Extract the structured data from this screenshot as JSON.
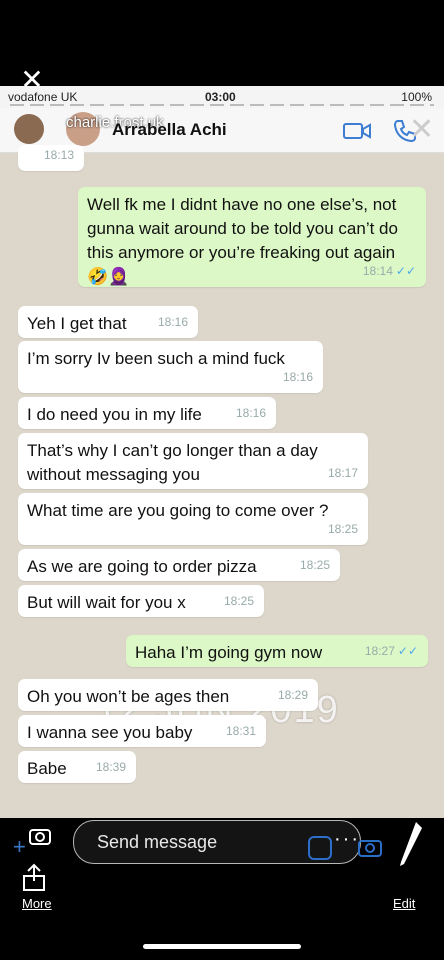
{
  "story": {
    "close_icon": "✕",
    "more_label": "More",
    "edit_label": "Edit"
  },
  "status_bar": {
    "carrier": "vodafone UK",
    "time": "03:00",
    "battery": "100%"
  },
  "header": {
    "overlay_username": "charlie.frost.uk",
    "contact_name": "Arrabella Achi"
  },
  "chat": {
    "top_timestamp": "18:13",
    "date_overlay": "12 JUN 2019",
    "messages": [
      {
        "dir": "out",
        "text": "Well fk me I didnt have no one else’s, not gunna wait around to be told you can’t do this anymore or you’re freaking out again 🤣🧕",
        "time": "18:14"
      },
      {
        "dir": "in",
        "text": "Yeh I get that",
        "time": "18:16"
      },
      {
        "dir": "in",
        "text": "I’m sorry Iv been such a mind fuck",
        "time": "18:16"
      },
      {
        "dir": "in",
        "text": "I do need you in my life",
        "time": "18:16"
      },
      {
        "dir": "in",
        "text": "That’s why I can’t go longer than a day without messaging you",
        "time": "18:17"
      },
      {
        "dir": "in",
        "text": "What time are you going to come over ?",
        "time": "18:25"
      },
      {
        "dir": "in",
        "text": "As we are going to order pizza",
        "time": "18:25"
      },
      {
        "dir": "in",
        "text": "But will wait for you x",
        "time": "18:25"
      },
      {
        "dir": "out",
        "text": "Haha I’m going gym now",
        "time": "18:27"
      },
      {
        "dir": "in",
        "text": "Oh you won’t be ages then",
        "time": "18:29"
      },
      {
        "dir": "in",
        "text": "I wanna see you baby",
        "time": "18:31"
      },
      {
        "dir": "in",
        "text": "Babe",
        "time": "18:39"
      },
      {
        "dir": "in",
        "text": "👀",
        "time": ""
      }
    ]
  },
  "composer": {
    "placeholder": "Send message"
  },
  "colors": {
    "incoming": "#ffffff",
    "outgoing": "#dcf8c6",
    "tick": "#4ea9ea",
    "accent": "#3d7ed3"
  }
}
